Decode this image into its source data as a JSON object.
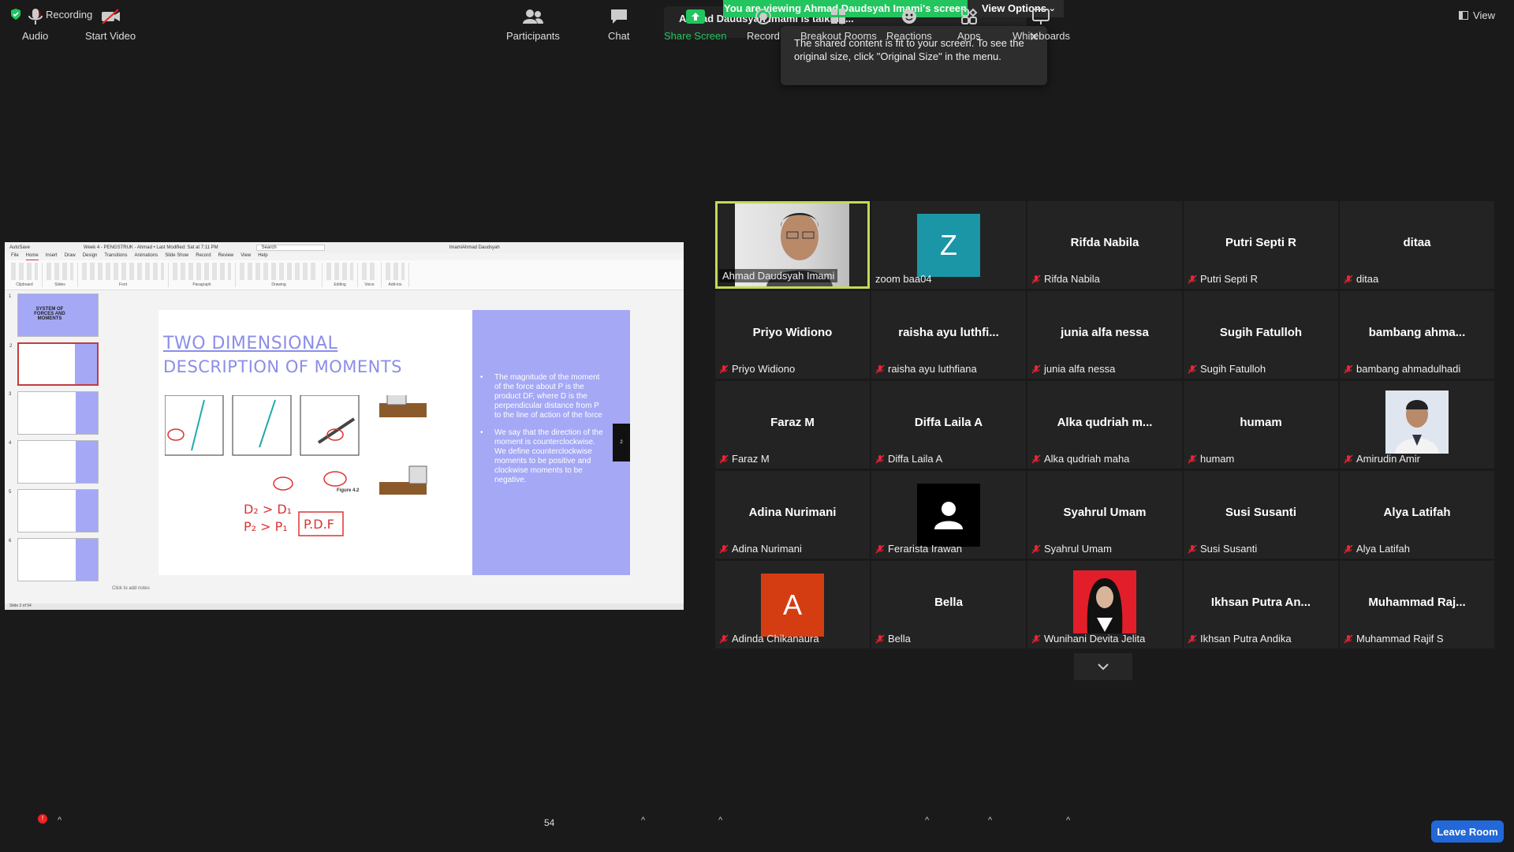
{
  "top": {
    "recording": "Recording",
    "viewing_banner": "You are viewing Ahmad Daudsyah Imami's screen",
    "view_options": "View Options",
    "talking": "Ahmad Daudsyah Imami is talking...",
    "tooltip": "The shared content is fit to your screen. To see the original size, click \"Original Size\" in the menu.",
    "view": "View"
  },
  "ppt": {
    "titlebar": [
      "AutoSave",
      "Week 4 - PENGSTRUK - Ahmad • Last Modified: Sat at 7:11 PM",
      "Search",
      "ImamiAhmad Daudsyah"
    ],
    "menu": [
      "File",
      "Home",
      "Insert",
      "Draw",
      "Design",
      "Transitions",
      "Animations",
      "Slide Show",
      "Record",
      "Review",
      "View",
      "Help"
    ],
    "ribbon_groups": [
      "Clipboard",
      "Slides",
      "Font",
      "Paragraph",
      "Drawing",
      "Editing",
      "Voice",
      "Add-ins"
    ],
    "thumb_title": "SYSTEM OF FORCES AND MOMENTS",
    "slide_title_1": "TWO DIMENSIONAL",
    "slide_title_2": "DESCRIPTION OF MOMENTS",
    "bullet_1": "The magnitude of the moment of the force about P is the product DF, where D is the perpendicular distance from P to the line of action of the force",
    "bullet_2": "We say that the direction of the moment is counterclockwise. We define counterclockwise moments to be positive and clockwise moments to be negative.",
    "figure_caption": "Figure 4.2",
    "notes": "Click to add notes",
    "status": "Slide 2 of 54"
  },
  "gallery": [
    {
      "big": "",
      "name": "Ahmad Daudsyah Imami",
      "muted": false,
      "kind": "photo-man",
      "active": true
    },
    {
      "big": "",
      "name": "zoom baa04",
      "muted": false,
      "kind": "letter",
      "letter": "Z",
      "color": "#1b96a6"
    },
    {
      "big": "Rifda Nabila",
      "name": "Rifda Nabila",
      "muted": true
    },
    {
      "big": "Putri Septi R",
      "name": "Putri Septi R",
      "muted": true
    },
    {
      "big": "ditaa",
      "name": "ditaa",
      "muted": true
    },
    {
      "big": "Priyo Widiono",
      "name": "Priyo Widiono",
      "muted": true
    },
    {
      "big": "raisha ayu luthfi...",
      "name": "raisha ayu luthfiana",
      "muted": true
    },
    {
      "big": "junia alfa nessa",
      "name": "junia alfa nessa",
      "muted": true
    },
    {
      "big": "Sugih Fatulloh",
      "name": "Sugih Fatulloh",
      "muted": true
    },
    {
      "big": "bambang ahma...",
      "name": "bambang ahmadulhadi",
      "muted": true
    },
    {
      "big": "Faraz M",
      "name": "Faraz M",
      "muted": true
    },
    {
      "big": "Diffa Laila A",
      "name": "Diffa Laila A",
      "muted": true
    },
    {
      "big": "Alka qudriah m...",
      "name": "Alka qudriah maha",
      "muted": true
    },
    {
      "big": "humam",
      "name": "humam",
      "muted": true
    },
    {
      "big": "",
      "name": "Amirudin Amir",
      "muted": true,
      "kind": "photo-amir"
    },
    {
      "big": "Adina Nurimani",
      "name": "Adina Nurimani",
      "muted": true
    },
    {
      "big": "",
      "name": "Ferarista Irawan",
      "muted": true,
      "kind": "person"
    },
    {
      "big": "Syahrul Umam",
      "name": "Syahrul Umam",
      "muted": true
    },
    {
      "big": "Susi Susanti",
      "name": "Susi Susanti",
      "muted": true
    },
    {
      "big": "Alya Latifah",
      "name": "Alya Latifah",
      "muted": true
    },
    {
      "big": "",
      "name": "Adinda Chikanaura",
      "muted": true,
      "kind": "letter",
      "letter": "A",
      "color": "#d43d12"
    },
    {
      "big": "Bella",
      "name": "Bella",
      "muted": true
    },
    {
      "big": "",
      "name": "Wunihani Devita Jelita",
      "muted": true,
      "kind": "photo-woman"
    },
    {
      "big": "Ikhsan Putra An...",
      "name": "Ikhsan Putra Andika",
      "muted": true
    },
    {
      "big": "Muhammad Raj...",
      "name": "Muhammad Rajif S",
      "muted": true
    }
  ],
  "toolbar": {
    "audio": "Audio",
    "audio_badge": "!",
    "start_video": "Start Video",
    "participants": "Participants",
    "participants_count": "54",
    "chat": "Chat",
    "share_screen": "Share Screen",
    "record": "Record",
    "breakout": "Breakout Rooms",
    "reactions": "Reactions",
    "apps": "Apps",
    "whiteboards": "Whiteboards",
    "leave": "Leave Room"
  },
  "colors": {
    "share_green": "#22c55e",
    "leave_blue": "#2268d8",
    "active_border": "#c8d854",
    "slide_band": "#a4a8f5"
  }
}
